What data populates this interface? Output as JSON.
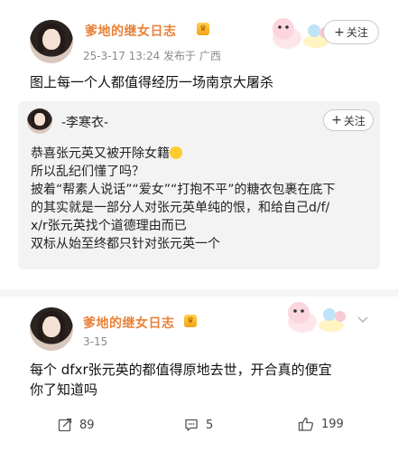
{
  "top_post": {
    "author": "爹地的继女日志",
    "meta": "25-3-17 13:24  发布于 广西",
    "follow_label": "关注",
    "body": "图上每一个人都值得经历一场南京大屠杀"
  },
  "quoted_post": {
    "author": "-李寒衣-",
    "follow_label": "关注",
    "lines": [
      "恭喜张元英又被开除女籍",
      "所以乱纪们懂了吗？",
      "披着“帮素人说话”“爱女”“打抱不平”的糖衣包裹在底下",
      "的其实就是一部分人对张元英单纯的恨，和给自己d/f/",
      "x/r张元英找个道德理由而已",
      "双标从始至终都只针对张元英一个"
    ]
  },
  "reply": {
    "author": "爹地的继女日志",
    "date": "3-15",
    "lines": [
      "每个 dfxr张元英的都值得原地去世，开合真的便宜",
      "你了知道吗"
    ]
  },
  "actions": {
    "repost_count": "89",
    "comment_count": "5",
    "like_count": "199"
  },
  "icons": {
    "crown": "crown-badge-icon",
    "plus": "plus-icon",
    "chevron": "chevron-down-icon",
    "repost": "repost-icon",
    "comment": "comment-icon",
    "like": "thumbs-up-icon"
  },
  "colors": {
    "author_name": "#e8823a",
    "meta_gray": "#8a8a8a",
    "quote_bg": "#f3f3f3",
    "divider": "#f5f5f5"
  }
}
